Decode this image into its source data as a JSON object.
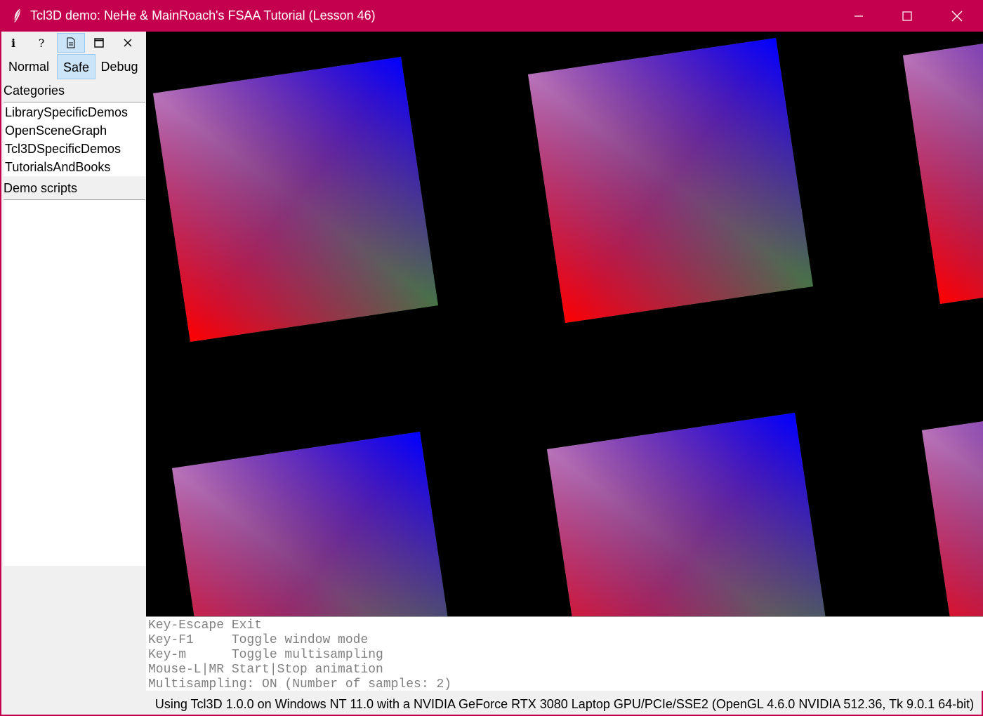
{
  "window": {
    "title": "Tcl3D demo: NeHe & MainRoach's FSAA Tutorial (Lesson 46)",
    "accent_color": "#c4004e"
  },
  "toolbar": {
    "icons": [
      {
        "name": "info-icon",
        "glyph": "i"
      },
      {
        "name": "help-icon",
        "glyph": "?"
      },
      {
        "name": "document-icon",
        "glyph": "🗎",
        "active": true
      },
      {
        "name": "window-mode-icon",
        "glyph": "🗖"
      },
      {
        "name": "close-icon",
        "glyph": "✕"
      }
    ],
    "modes": [
      "Normal",
      "Safe",
      "Debug"
    ],
    "active_mode": "Safe"
  },
  "categories": {
    "label": "Categories",
    "items": [
      "LibrarySpecificDemos",
      "OpenSceneGraph",
      "Tcl3DSpecificDemos",
      "TutorialsAndBooks"
    ]
  },
  "demo_scripts": {
    "label": "Demo scripts",
    "items": []
  },
  "console": {
    "lines": [
      "Key-Escape Exit",
      "Key-F1     Toggle window mode",
      "Key-m      Toggle multisampling",
      "Mouse-L|MR Start|Stop animation",
      "Multisampling: ON (Number of samples: 2)"
    ]
  },
  "status": {
    "text": "Using Tcl3D 1.0.0 on Windows NT 11.0 with a NVIDIA GeForce RTX 3080 Laptop GPU/PCIe/SSE2 (OpenGL 4.6.0 NVIDIA 512.36, Tk 9.0.1 64-bit)"
  }
}
